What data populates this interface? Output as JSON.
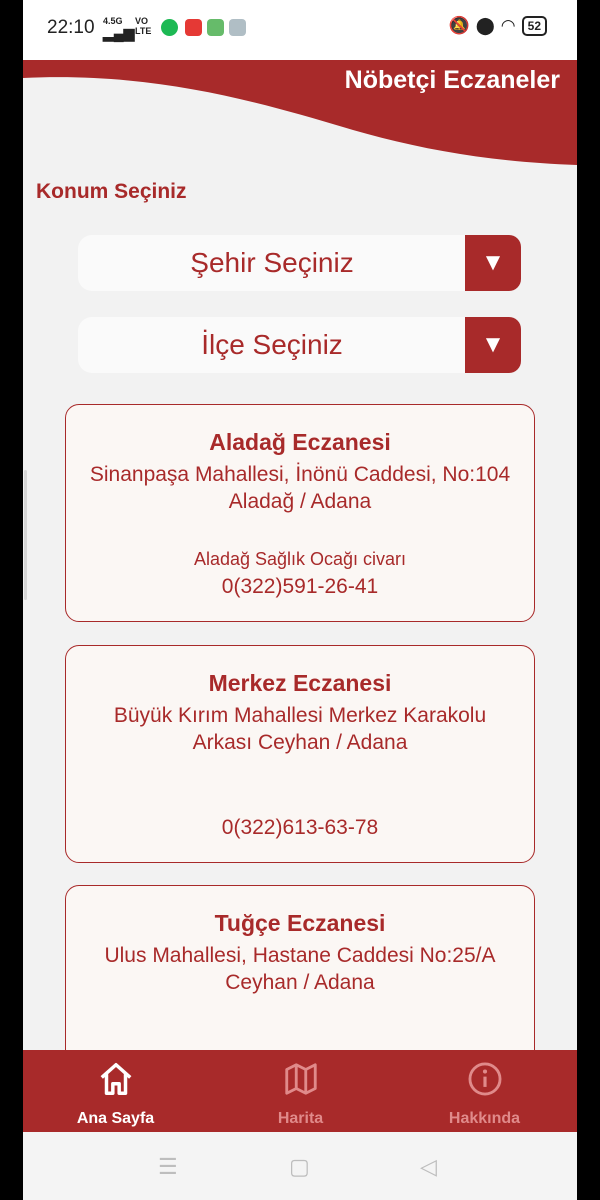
{
  "status_bar": {
    "time": "22:10",
    "network_top": "4.5G",
    "network_mid": "VO",
    "network_bottom": "LTE",
    "battery": "52"
  },
  "header": {
    "title": "Nöbetçi Eczaneler"
  },
  "location": {
    "label": "Konum Seçiniz",
    "city_placeholder": "Şehir Seçiniz",
    "district_placeholder": "İlçe Seçiniz",
    "dropdown_arrow": "▼"
  },
  "pharmacies": [
    {
      "name": "Aladağ Eczanesi",
      "address_line1": "Sinanpaşa Mahallesi, İnönü Caddesi, No:104",
      "address_line2": "Aladağ / Adana",
      "note": "Aladağ Sağlık Ocağı civarı",
      "phone": "0(322)591-26-41"
    },
    {
      "name": "Merkez Eczanesi",
      "address_line1": "Büyük Kırım Mahallesi Merkez Karakolu",
      "address_line2": "Arkası Ceyhan / Adana",
      "note": "",
      "phone": "0(322)613-63-78"
    },
    {
      "name": "Tuğçe Eczanesi",
      "address_line1": "Ulus Mahallesi, Hastane Caddesi No:25/A",
      "address_line2": "Ceyhan / Adana",
      "note": "",
      "phone": ""
    }
  ],
  "bottom_nav": {
    "items": [
      {
        "label": "Ana Sayfa",
        "icon": "home-icon",
        "active": true
      },
      {
        "label": "Harita",
        "icon": "map-icon",
        "active": false
      },
      {
        "label": "Hakkında",
        "icon": "info-icon",
        "active": false
      }
    ]
  },
  "colors": {
    "primary": "#a82a2a",
    "background": "#f2f2f2",
    "card_bg": "#fbf7f4",
    "nav_inactive": "#e08a8a"
  }
}
